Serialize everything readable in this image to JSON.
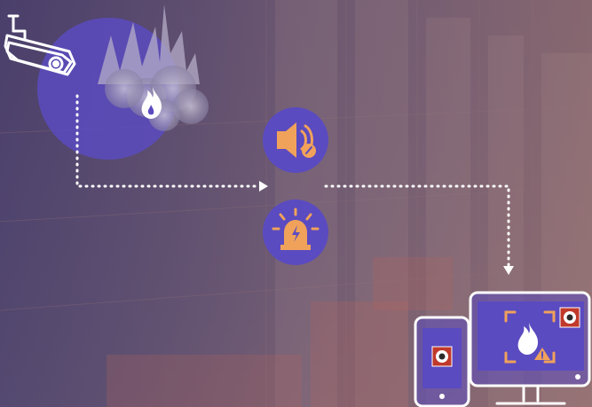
{
  "colors": {
    "overlay": "#3f3561",
    "accent_circle": "#5b4bc0",
    "icon_orange": "#f0a25a",
    "white": "#ffffff",
    "camera_red": "#c0392b"
  },
  "icons": {
    "camera": "security-camera-icon",
    "smoke": "smoke-fire-icon",
    "flame": "flame-icon",
    "speaker": "speaker-alarm-icon",
    "beacon": "alarm-beacon-icon",
    "phone": "mobile-phone-icon",
    "monitor": "desktop-monitor-icon",
    "warning": "warning-icon"
  }
}
